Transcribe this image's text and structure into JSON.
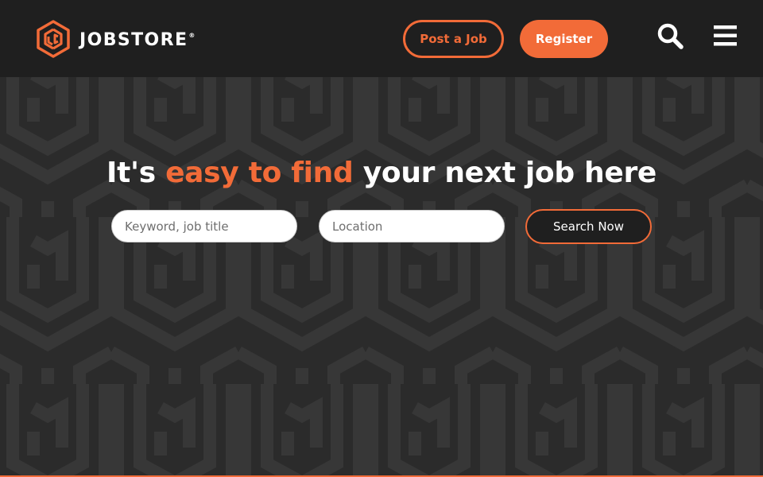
{
  "brand": {
    "name": "JOBSTORE",
    "registered_mark": "®",
    "logo_icon": "hexagon-logo-icon"
  },
  "header": {
    "post_job_label": "Post a Job",
    "register_label": "Register",
    "search_icon": "search-icon",
    "menu_icon": "hamburger-menu-icon"
  },
  "hero": {
    "headline_pre": "It's ",
    "headline_accent": "easy to find",
    "headline_post": " your next job here",
    "keyword_placeholder": "Keyword, job title",
    "location_placeholder": "Location",
    "search_button_label": "Search Now"
  },
  "colors": {
    "accent": "#f26b38",
    "header_bg": "#1f1f1f",
    "hero_bg": "#2b2b2b",
    "pattern": "#373737",
    "text_light": "#ffffff"
  }
}
